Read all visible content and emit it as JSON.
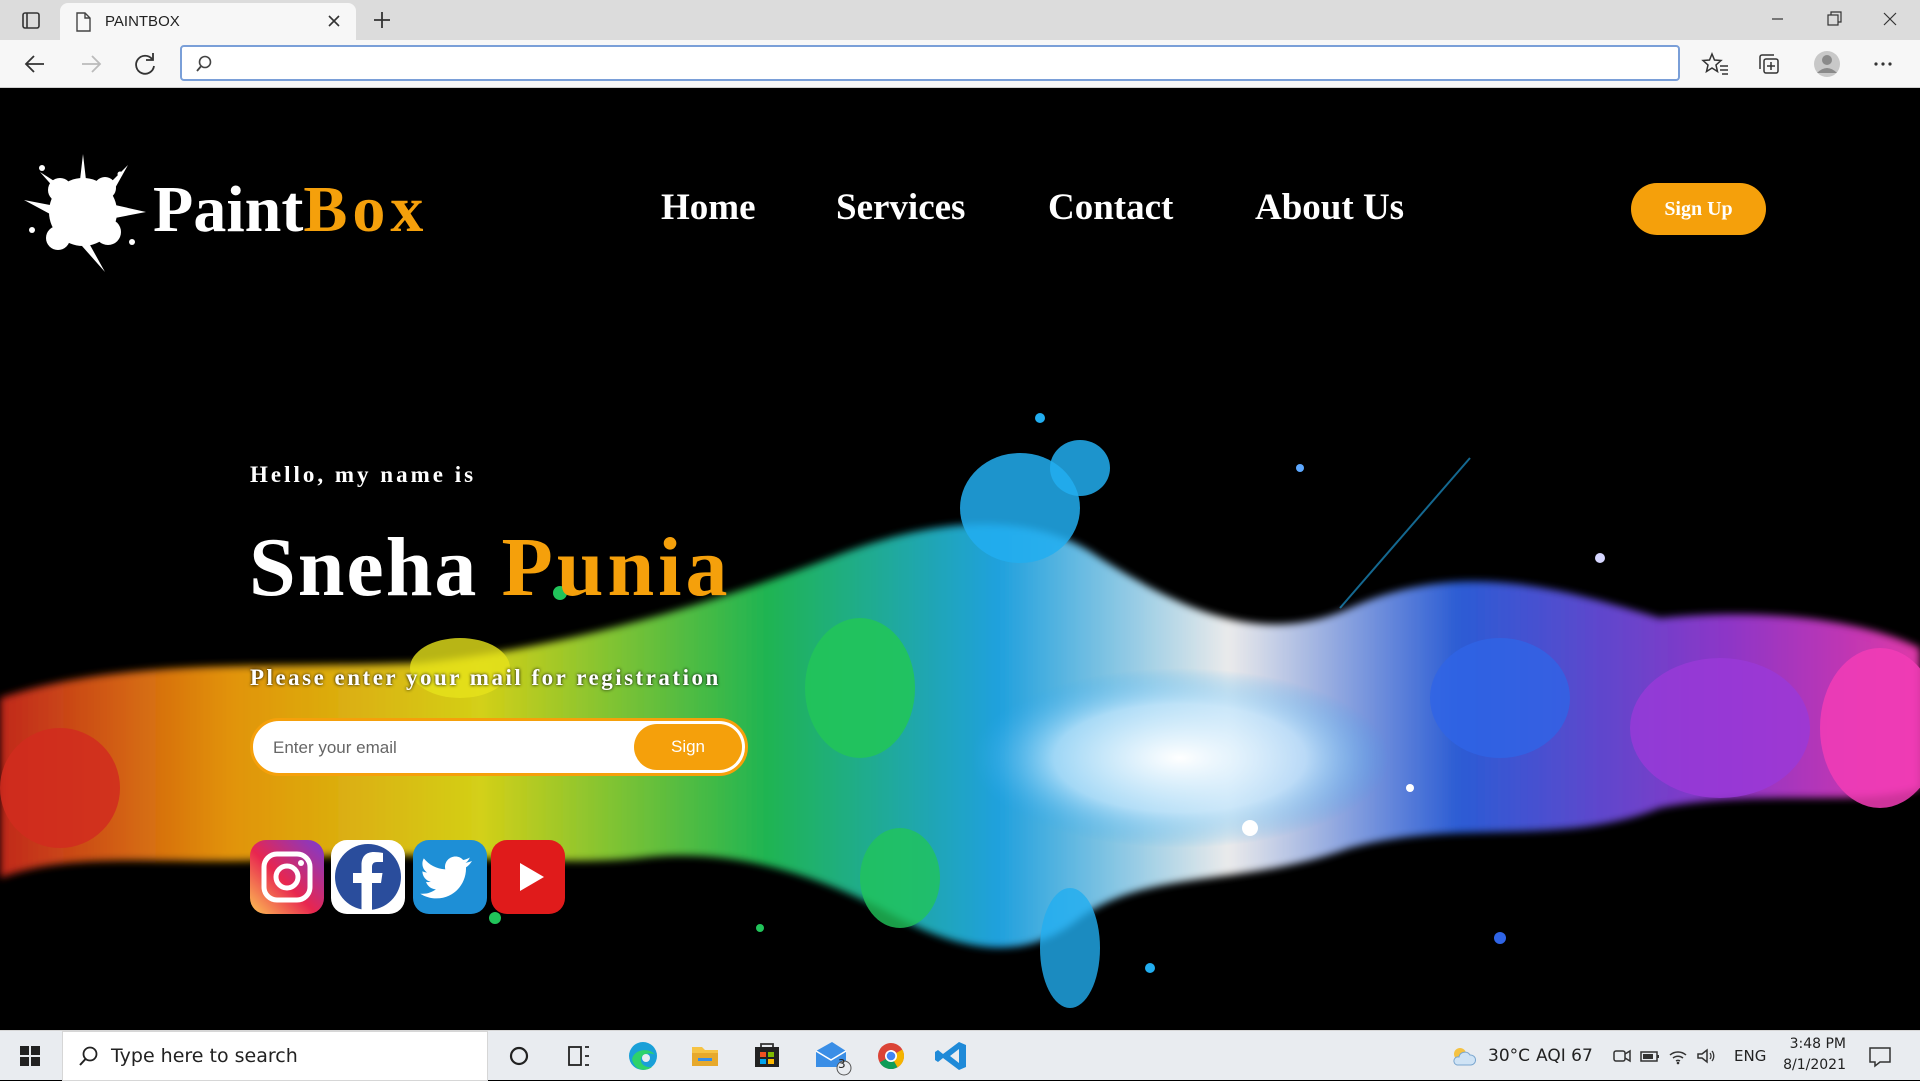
{
  "browser": {
    "tab_title": "PAINTBOX",
    "address_value": "",
    "address_placeholder": ""
  },
  "site": {
    "logo_part1": "Paint",
    "logo_part2": "Box",
    "nav": [
      {
        "label": "Home"
      },
      {
        "label": "Services"
      },
      {
        "label": "Contact"
      },
      {
        "label": "About Us"
      }
    ],
    "signup_label": "Sign Up",
    "hello": "Hello, my name is",
    "first_name": "Sneha",
    "last_name": "Punia",
    "registration_text": "Please enter your mail for registration",
    "email_placeholder": "Enter your email",
    "sign_label": "Sign",
    "social_icons": [
      "instagram-icon",
      "facebook-icon",
      "twitter-icon",
      "youtube-icon"
    ],
    "accent_color": "#f5a00b"
  },
  "taskbar": {
    "search_placeholder": "Type here to search",
    "mail_badge": "3",
    "weather": "30°C",
    "aqi": "AQI 67",
    "language": "ENG",
    "time": "3:48 PM",
    "date": "8/1/2021",
    "apps": [
      "cortana-icon",
      "task-view-icon",
      "edge-icon",
      "file-explorer-icon",
      "store-icon",
      "mail-icon",
      "chrome-icon",
      "vscode-icon"
    ]
  }
}
